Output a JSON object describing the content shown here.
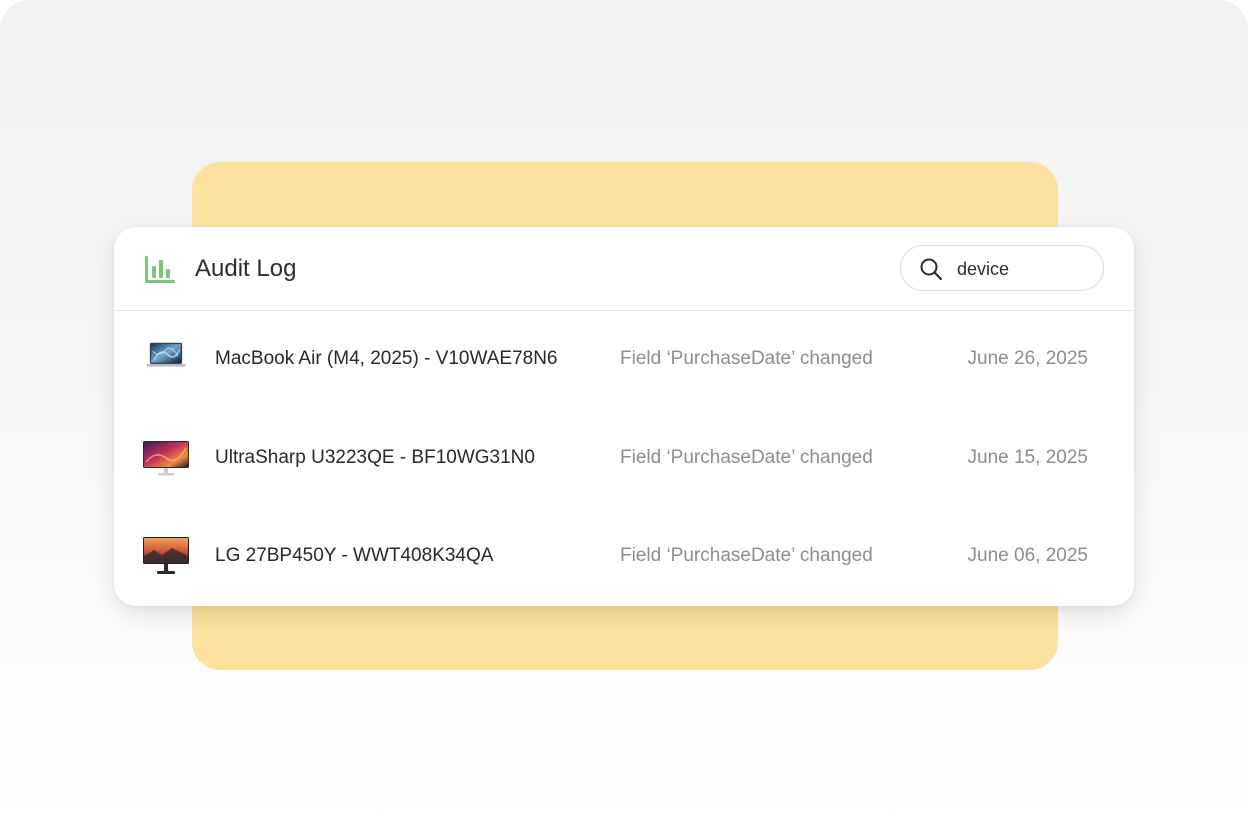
{
  "header": {
    "title": "Audit Log",
    "logo_icon": "bar-chart-icon",
    "accent_color": "#7cc576"
  },
  "search": {
    "icon": "search-icon",
    "value": "device"
  },
  "rows": [
    {
      "device": "MacBook Air (M4, 2025) - V10WAE78N6",
      "event": "Field ‘PurchaseDate’ changed",
      "date": "June 26, 2025",
      "thumbnail": "laptop-icon"
    },
    {
      "device": "UltraSharp U3223QE - BF10WG31N0",
      "event": "Field ‘PurchaseDate’ changed",
      "date": "June 15, 2025",
      "thumbnail": "monitor-icon"
    },
    {
      "device": "LG 27BP450Y - WWT408K34QA",
      "event": "Field ‘PurchaseDate’ changed",
      "date": "June 06, 2025",
      "thumbnail": "monitor-icon"
    }
  ],
  "colors": {
    "backdrop": "#fde29f",
    "card": "#ffffff",
    "primary_text": "#26282e",
    "secondary_text": "#8b8d93"
  }
}
